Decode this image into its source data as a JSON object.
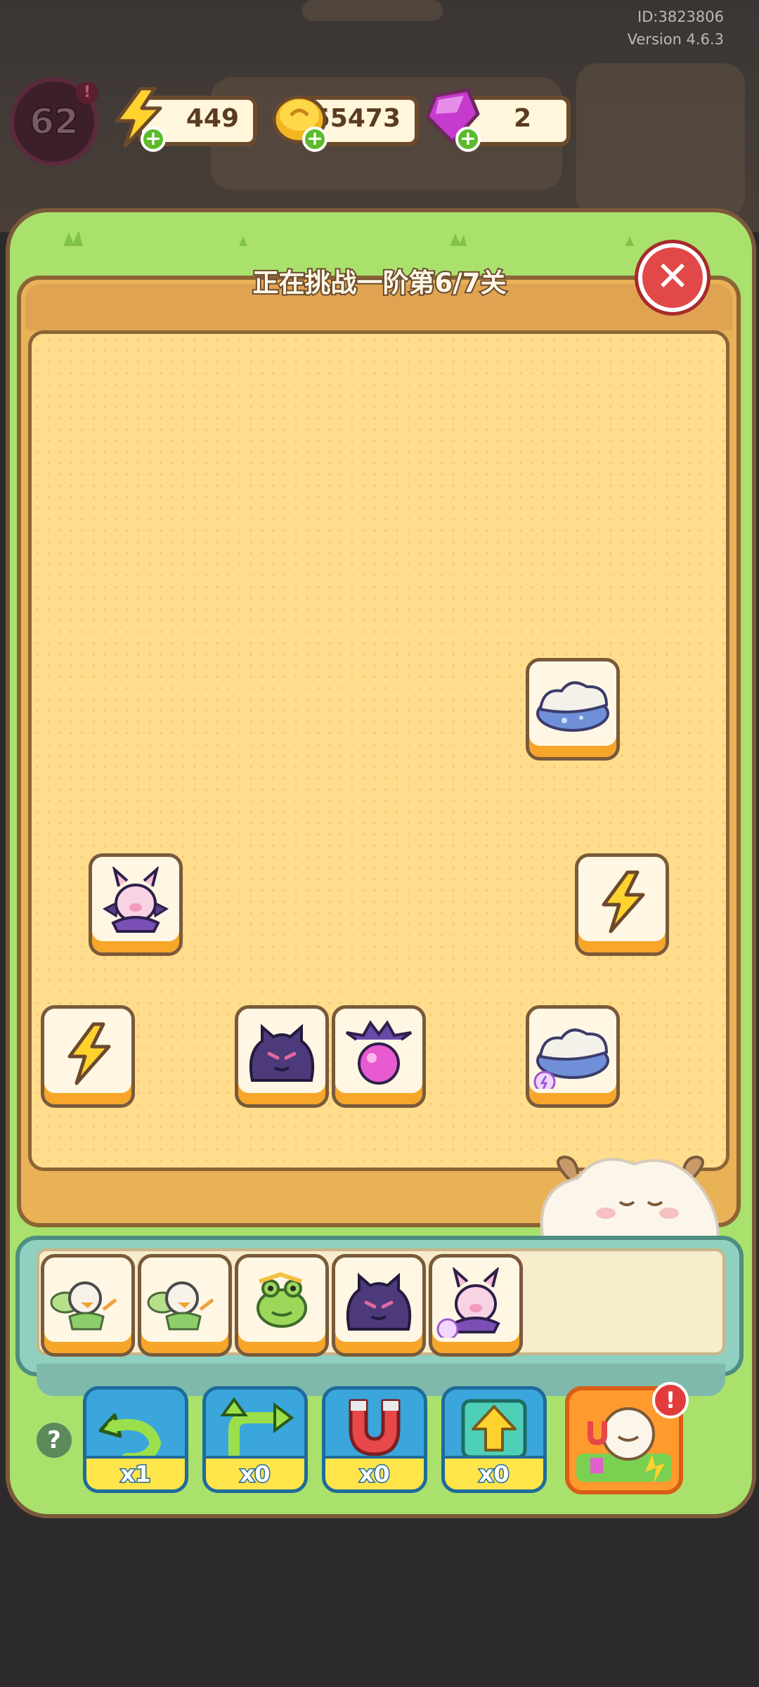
{
  "header": {
    "id_text": "ID:3823806",
    "version_text": "Version 4.6.3",
    "level": "62",
    "level_alert": "!",
    "energy": "449",
    "coins": "55473",
    "gems": "2"
  },
  "board": {
    "title": "正在挑战一阶第6/7关",
    "close_label": "✕",
    "tiles": [
      {
        "item": "cloud-puff"
      },
      {
        "item": "bat-pig"
      },
      {
        "item": "lightning"
      },
      {
        "item": "lightning"
      },
      {
        "item": "dark-cat"
      },
      {
        "item": "pink-potion"
      },
      {
        "item": "cloud-puff"
      }
    ]
  },
  "tray": {
    "slots": [
      {
        "item": "fairy-duck"
      },
      {
        "item": "fairy-duck"
      },
      {
        "item": "green-frog"
      },
      {
        "item": "dark-cat"
      },
      {
        "item": "bat-pig"
      }
    ]
  },
  "tools": {
    "help_label": "?",
    "undo_count": "x1",
    "shuffle_count": "x0",
    "magnet_count": "x0",
    "lift_count": "x0",
    "special_alert": "!"
  },
  "colors": {
    "grass": "#a9e16c",
    "board": "#ffdd8c",
    "tile_face": "#fff7e4",
    "tile_edge": "#f7a62a",
    "tool_blue": "#3aa6dc",
    "close_red": "#e24848"
  }
}
